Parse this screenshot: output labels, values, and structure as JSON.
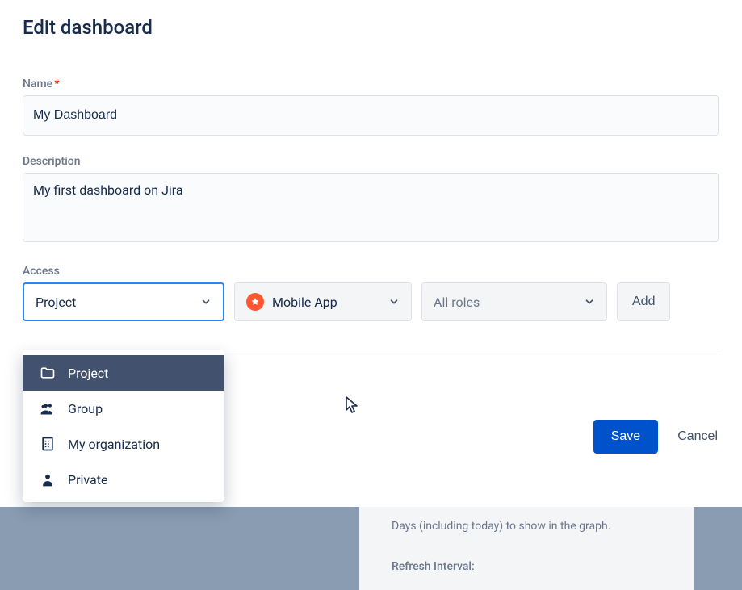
{
  "title": "Edit dashboard",
  "fields": {
    "name": {
      "label": "Name",
      "required": "*",
      "value": "My Dashboard"
    },
    "description": {
      "label": "Description",
      "value": "My first dashboard on Jira"
    },
    "access": {
      "label": "Access",
      "share_type_value": "Project",
      "project_value": "Mobile App",
      "roles_placeholder": "All roles",
      "add_label": "Add",
      "options": [
        {
          "label": "Project"
        },
        {
          "label": "Group"
        },
        {
          "label": "My organization"
        },
        {
          "label": "Private"
        }
      ]
    }
  },
  "actions": {
    "save": "Save",
    "cancel": "Cancel"
  },
  "background": {
    "days_text": "Days (including today) to show in the graph.",
    "refresh_label": "Refresh Interval:"
  }
}
